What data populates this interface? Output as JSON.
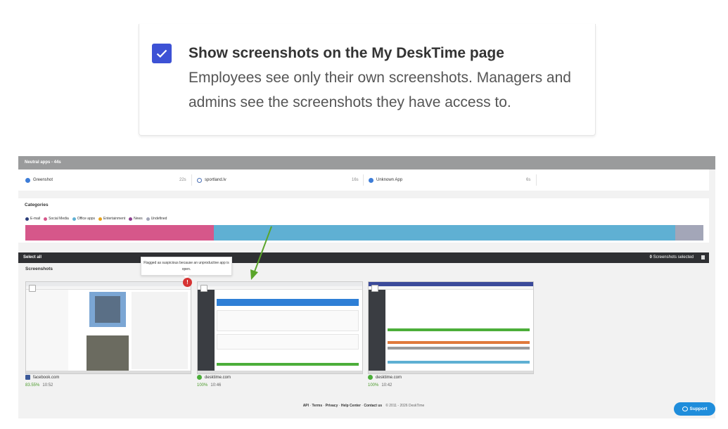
{
  "setting": {
    "checked": true,
    "title": "Show screenshots on the My DeskTime page",
    "description": "Employees see only their own screenshots. Managers and admins see the screenshots they have access to."
  },
  "neutral": {
    "header": "Neutral apps - 44s",
    "apps": [
      {
        "name": "Greenshot",
        "time": "22s",
        "icon": "greenshot-icon"
      },
      {
        "name": "sportland.lv",
        "time": "16s",
        "icon": "globe-icon"
      },
      {
        "name": "Unknown App",
        "time": "6s",
        "icon": "app-icon"
      }
    ]
  },
  "categories": {
    "title": "Categories",
    "legend": [
      {
        "label": "E-mail",
        "color": "#2c3e7a"
      },
      {
        "label": "Social Media",
        "color": "#d6578a"
      },
      {
        "label": "Office apps",
        "color": "#5fb0d3"
      },
      {
        "label": "Entertainment",
        "color": "#e8a31c"
      },
      {
        "label": "News",
        "color": "#8e3f8f"
      },
      {
        "label": "Undefined",
        "color": "#a3a6b8"
      }
    ],
    "bar_segments": [
      {
        "category": "Social Media",
        "fraction": 0.278,
        "color": "#d6578a"
      },
      {
        "category": "Office apps",
        "fraction": 0.68,
        "color": "#5fb0d3"
      },
      {
        "category": "Undefined",
        "fraction": 0.042,
        "color": "#a3a6b8"
      }
    ]
  },
  "screenshots_bar": {
    "select_all": "Select all",
    "count": "0",
    "selected_label": " Screenshots selected"
  },
  "screenshots": {
    "title": "Screenshots",
    "tooltip": "Flagged as suspicious because an unproductive app is open.",
    "items": [
      {
        "app": "facebook.com",
        "percent": "83.55%",
        "time": "10:52",
        "icon": "facebook-icon",
        "flagged": true
      },
      {
        "app": "desktime.com",
        "percent": "100%",
        "time": "10:46",
        "icon": "desktime-icon",
        "flagged": false
      },
      {
        "app": "desktime.com",
        "percent": "100%",
        "time": "10:42",
        "icon": "desktime-icon",
        "flagged": false
      }
    ]
  },
  "footer": {
    "links": [
      "API",
      "Terms",
      "Privacy",
      "Help Center",
      "Contact us"
    ],
    "separator": " · ",
    "copyright": "© 2011 - 2026 DeskTime"
  },
  "support": {
    "label": "Support"
  },
  "colors": {
    "accent": "#3d52d5",
    "arrow": "#5aa52a",
    "support": "#1f8ddb",
    "productive": "#4a9a2a"
  }
}
